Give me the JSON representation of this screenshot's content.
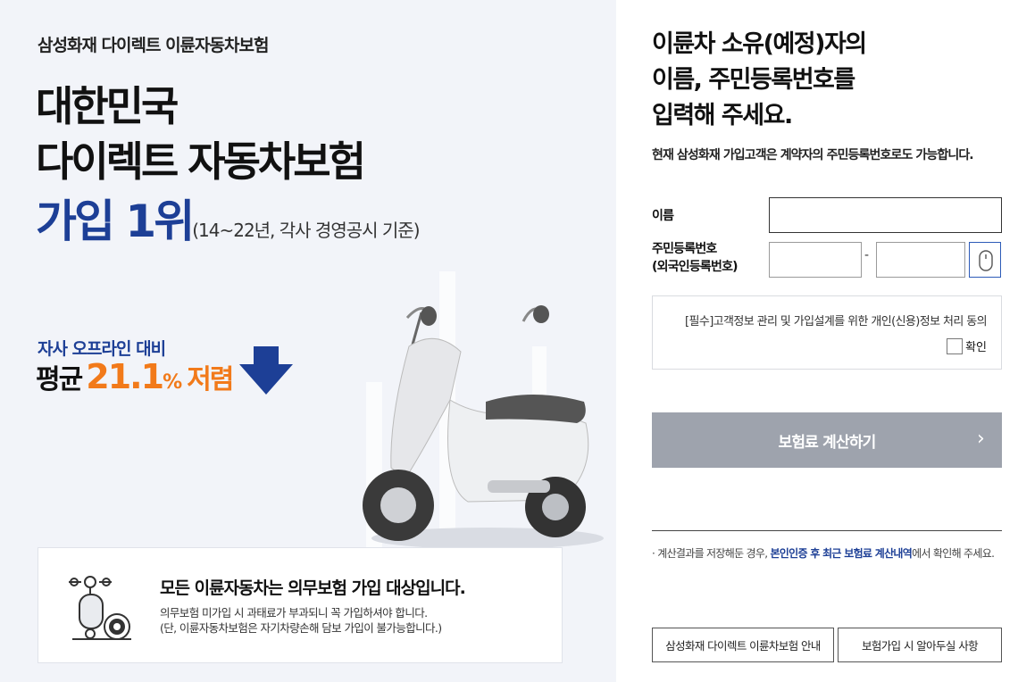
{
  "left": {
    "brand": "삼성화재 다이렉트 이륜자동차보험",
    "headline_line1": "대한민국",
    "headline_line2": "다이렉트 자동차보험",
    "rank": "가입 1위",
    "rank_note": "(14~22년, 각사 경영공시 기준)",
    "offline_compare": "자사 오프라인 대비",
    "avg_prefix": "평균",
    "avg_value": "21.1",
    "avg_unit": "%",
    "avg_suffix": "저렴",
    "notice": {
      "title": "모든 이륜자동차는 의무보험 가입 대상입니다.",
      "line1": "의무보험 미가입 시 과태료가 부과되니 꼭 가입하셔야 합니다.",
      "line2": "(단, 이륜자동차보험은 자기차량손해 담보 가입이 불가능합니다.)",
      "icon": "scooter-gear-icon"
    }
  },
  "right": {
    "title_line1": "이륜차 소유(예정)자의",
    "title_line2": "이름, 주민등록번호를",
    "title_line3": "입력해 주세요.",
    "subtitle": "현재 삼성화재 가입고객은 계약자의 주민등록번호로도 가능합니다.",
    "name_label": "이름",
    "name_value": "",
    "rrn_label_line1": "주민등록번호",
    "rrn_label_line2": "(외국인등록번호)",
    "rrn_front_value": "",
    "rrn_back_value": "",
    "rrn_separator": "-",
    "mouse_icon": "mouse-icon",
    "consent_text": "[필수]고객정보 관리 및 가입설계를 위한 개인(신용)정보 처리 동의",
    "consent_check_label": "확인",
    "calc_button": "보험료 계산하기",
    "calc_chevron": "›",
    "note_prefix": "· 계산결과를 저장해둔 경우, ",
    "note_link": "본인인증 후 최근 보험료 계산내역",
    "note_suffix": "에서 확인해 주세요.",
    "guide_button": "삼성화재 다이렉트 이륜차보험 안내",
    "info_button": "보험가입 시 알아두실 사항"
  },
  "colors": {
    "brand_blue": "#1d3f96",
    "accent_orange": "#f27a1a",
    "left_bg": "#f2f4f9",
    "button_disabled": "#9ea3ad"
  }
}
